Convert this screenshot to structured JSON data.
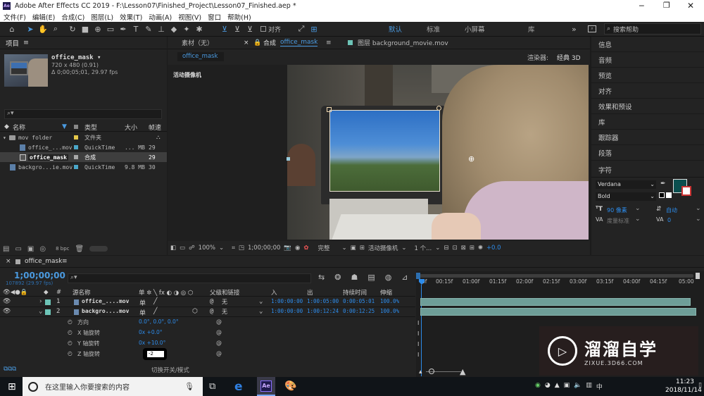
{
  "app": {
    "title": "Adobe After Effects CC 2019 - F:\\Lesson07\\Finished_Project\\Lesson07_Finished.aep *",
    "logo": "Ae"
  },
  "menu": [
    "文件(F)",
    "编辑(E)",
    "合成(C)",
    "图层(L)",
    "效果(T)",
    "动画(A)",
    "视图(V)",
    "窗口",
    "帮助(H)"
  ],
  "toolbar": {
    "snap_label": "对齐",
    "workspaces": [
      "默认",
      "标准",
      "小屏幕",
      "库"
    ],
    "search_placeholder": "搜索帮助"
  },
  "project": {
    "title": "项目",
    "item_name": "office_mask",
    "item_dims": "720 x 480 (0.91)",
    "item_duration": "Δ 0;00;05;01, 29.97 fps",
    "search_placeholder": "",
    "headers": [
      "名称",
      "类型",
      "大小",
      "帧速"
    ],
    "rows": [
      {
        "name": "mov folder",
        "type": "文件夹",
        "size": "",
        "fps": "",
        "color": "#e6c84a"
      },
      {
        "name": "office_...mov",
        "type": "QuickTime",
        "size": "... MB",
        "fps": "29",
        "color": "#4aa6c8"
      },
      {
        "name": "office_mask",
        "type": "合成",
        "size": "",
        "fps": "29",
        "color": "#a8a8a8"
      },
      {
        "name": "backgro...ie.mov",
        "type": "QuickTime",
        "size": "9.8 MB",
        "fps": "30",
        "color": "#4aa6c8"
      }
    ],
    "footer_bpc": "8 bpc"
  },
  "viewer": {
    "tab_footage": "素材（无）",
    "tab_comp_prefix": "合成",
    "tab_comp_name": "office_mask",
    "tab_layer": "图层 background_movie.mov",
    "subtab": "office_mask",
    "renderer": "渲染器:",
    "renderer_value": "经典 3D",
    "camera_label": "活动摄像机",
    "footer": {
      "zoom": "100%",
      "timecode": "1;00;00;00",
      "quality": "完整",
      "camera": "活动摄像机",
      "views": "1 个...",
      "exposure": "+0.0"
    }
  },
  "right_panel": {
    "items": [
      "信息",
      "音频",
      "预览",
      "对齐",
      "效果和预设",
      "库",
      "跟踪器",
      "段落"
    ],
    "char_title": "字符",
    "font": "Verdana",
    "style": "Bold",
    "font_size": "90 像素",
    "leading": "自动",
    "kerning": "度量标准",
    "tracking": "0",
    "fill_color": "#0b4f4f"
  },
  "timeline": {
    "tab": "office_mask",
    "timecode": "1;00;00;00",
    "fps_info": "107892 (29.97 fps)",
    "search_placeholder": "",
    "headers": {
      "name": "源名称",
      "parent": "父级和链接",
      "in": "入",
      "out": "出",
      "duration": "持续时间",
      "stretch": "伸缩"
    },
    "ruler": [
      "0f",
      "00:15f",
      "01:00f",
      "01:15f",
      "02:00f",
      "02:15f",
      "03:00f",
      "03:15f",
      "04:00f",
      "04:15f",
      "05:00"
    ],
    "layers": [
      {
        "num": "1",
        "name": "office_....mov",
        "parent": "无",
        "in": "1:00:00:00",
        "out": "1:00:05:00",
        "duration": "0:00:05:01",
        "stretch": "100.0%"
      },
      {
        "num": "2",
        "name": "backgro....mov",
        "parent": "无",
        "in": "1:00:00:00",
        "out": "1:00:12:24",
        "duration": "0:00:12:25",
        "stretch": "100.0%"
      }
    ],
    "props": [
      {
        "name": "方向",
        "value": "0.0°, 0.0°, 0.0°"
      },
      {
        "name": "X 轴旋转",
        "value": "0x +0.0°"
      },
      {
        "name": "Y 轴旋转",
        "value": "0x +10.0°"
      },
      {
        "name": "Z 轴旋转",
        "value": "-2"
      }
    ],
    "toggle_label": "切换开关/模式"
  },
  "taskbar": {
    "search": "在这里输入你要搜索的内容",
    "time": "11:23",
    "date": "2018/11/14"
  },
  "watermark": {
    "title": "溜溜自学",
    "url": "ZIXUE.3D66.COM"
  }
}
